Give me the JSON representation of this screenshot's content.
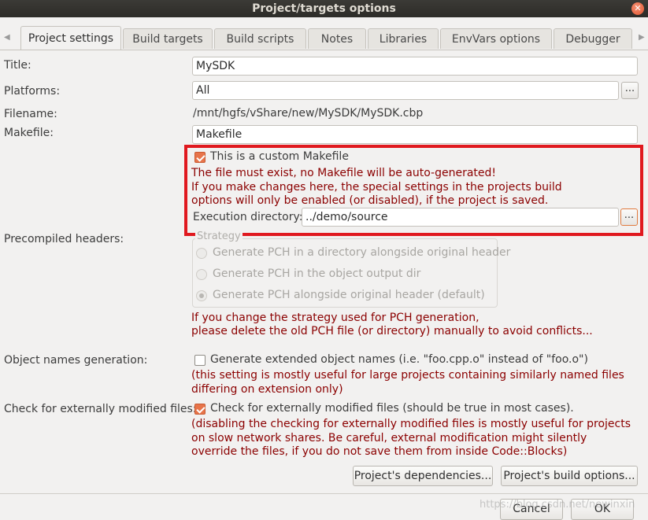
{
  "window": {
    "title": "Project/targets options"
  },
  "tabs": [
    {
      "label": "Project settings"
    },
    {
      "label": "Build targets"
    },
    {
      "label": "Build scripts"
    },
    {
      "label": "Notes"
    },
    {
      "label": "Libraries"
    },
    {
      "label": "EnvVars options"
    },
    {
      "label": "Debugger"
    }
  ],
  "form": {
    "title_label": "Title:",
    "title_value": "MySDK",
    "platforms_label": "Platforms:",
    "platforms_value": "All",
    "filename_label": "Filename:",
    "filename_value": "/mnt/hgfs/vShare/new/MySDK/MySDK.cbp",
    "makefile_label": "Makefile:",
    "makefile_value": "Makefile",
    "browse_label": "...",
    "custom_makefile": {
      "label": "This is a custom Makefile",
      "checked": true,
      "warning_1": "The file must exist, no Makefile will be auto-generated!",
      "warning_2": "If you make changes here, the special settings in the projects build",
      "warning_3": "options will only be enabled (or disabled), if the project is saved.",
      "exec_dir_label": "Execution directory:",
      "exec_dir_value": "../demo/source"
    },
    "pch": {
      "label": "Precompiled headers:",
      "strategy_title": "Strategy",
      "options": [
        "Generate PCH in a directory alongside original header",
        "Generate PCH in the object output dir",
        "Generate PCH alongside original header (default)"
      ],
      "selected": 2,
      "note_1": "If you change the strategy used for PCH generation,",
      "note_2": "please delete the old PCH file (or directory) manually to avoid conflicts..."
    },
    "object_names": {
      "label": "Object names generation:",
      "checkbox_label": "Generate extended object names (i.e. \"foo.cpp.o\" instead of \"foo.o\")",
      "checked": false,
      "note_1": "(this setting is mostly useful for large projects containing similarly named files",
      "note_2": "differing on extension only)"
    },
    "external_mod": {
      "label": "Check for externally modified files:",
      "checkbox_label": "Check for externally modified files (should be true in most cases).",
      "checked": true,
      "note_1": "(disabling the checking for externally modified files is mostly useful for projects",
      "note_2": "on slow network shares. Be careful, external modification might silently",
      "note_3": "override the files, if you do not save them from inside Code::Blocks)"
    },
    "dependencies_button": "Project's dependencies...",
    "build_options_button": "Project's build options..."
  },
  "footer": {
    "cancel": "Cancel",
    "ok": "OK",
    "watermark": "https://blog.csdn.net/newinxin"
  },
  "colors": {
    "accent": "#e7744a",
    "warning_text": "#8b0000",
    "highlight_border": "#e0191f"
  }
}
